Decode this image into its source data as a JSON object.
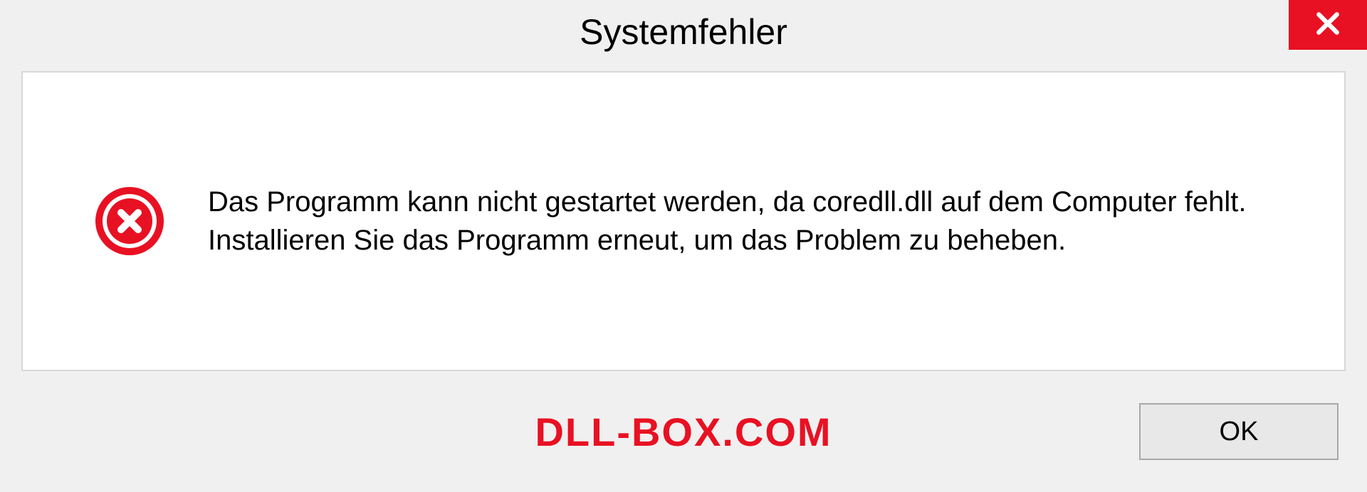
{
  "dialog": {
    "title": "Systemfehler",
    "message": "Das Programm kann nicht gestartet werden, da coredll.dll auf dem Computer fehlt. Installieren Sie das Programm erneut, um das Problem zu beheben.",
    "ok_label": "OK"
  },
  "watermark": "DLL-BOX.COM"
}
